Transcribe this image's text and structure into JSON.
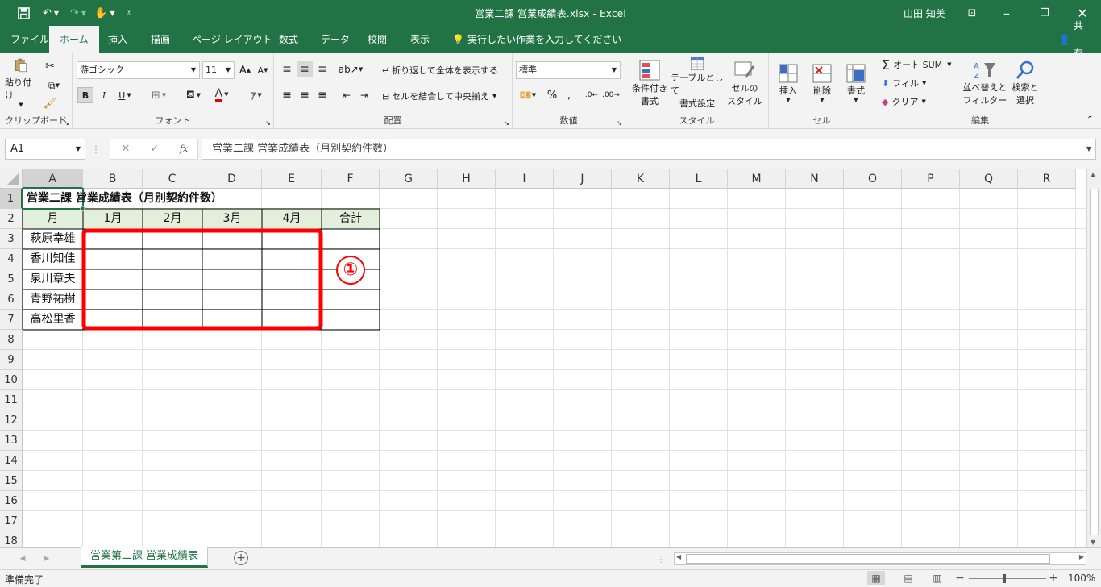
{
  "window": {
    "title": "営業二課 営業成績表.xlsx  -  Excel",
    "user": "山田 知美"
  },
  "tabs": [
    "ファイル",
    "ホーム",
    "挿入",
    "描画",
    "ページ レイアウト",
    "数式",
    "データ",
    "校閲",
    "表示"
  ],
  "tell_me": "実行したい作業を入力してください",
  "share": "共有",
  "ribbon": {
    "clipboard": {
      "paste": "貼り付け",
      "label": "クリップボード"
    },
    "font": {
      "name": "游ゴシック",
      "size": "11",
      "label": "フォント"
    },
    "alignment": {
      "wrap": "折り返して全体を表示する",
      "merge": "セルを結合して中央揃え",
      "label": "配置"
    },
    "number": {
      "format": "標準",
      "label": "数値"
    },
    "styles": {
      "conditional": [
        "条件付き",
        "書式"
      ],
      "table": [
        "テーブルとして",
        "書式設定"
      ],
      "cell": [
        "セルの",
        "スタイル"
      ],
      "label": "スタイル"
    },
    "cells": {
      "insert": "挿入",
      "delete": "削除",
      "format": "書式",
      "label": "セル"
    },
    "editing": {
      "autosum": "オート SUM",
      "fill": "フィル",
      "clear": "クリア",
      "sort": [
        "並べ替えと",
        "フィルター"
      ],
      "find": [
        "検索と",
        "選択"
      ],
      "label": "編集"
    }
  },
  "formula_bar": {
    "name_box": "A1",
    "formula": "営業二課 営業成績表（月別契約件数）"
  },
  "columns": [
    "A",
    "B",
    "C",
    "D",
    "E",
    "F",
    "G",
    "H",
    "I",
    "J",
    "K",
    "L",
    "M",
    "N",
    "O",
    "P",
    "Q",
    "R"
  ],
  "rows": [
    "1",
    "2",
    "3",
    "4",
    "5",
    "6",
    "7",
    "8",
    "9",
    "10",
    "11",
    "12",
    "13",
    "14",
    "15",
    "16",
    "17",
    "18"
  ],
  "sheet": {
    "title": "営業二課 営業成績表（月別契約件数）",
    "header": [
      "月",
      "1月",
      "2月",
      "3月",
      "4月",
      "合計"
    ],
    "names": [
      "萩原幸雄",
      "香川知佳",
      "泉川章夫",
      "青野祐樹",
      "高松里香"
    ]
  },
  "annotation": "①",
  "sheet_tab": "営業第二課 営業成績表",
  "status": {
    "ready": "準備完了",
    "zoom": "100%"
  },
  "colors": {
    "brand": "#217346",
    "highlight": "#ff0000",
    "header_fill": "#e2efda"
  }
}
